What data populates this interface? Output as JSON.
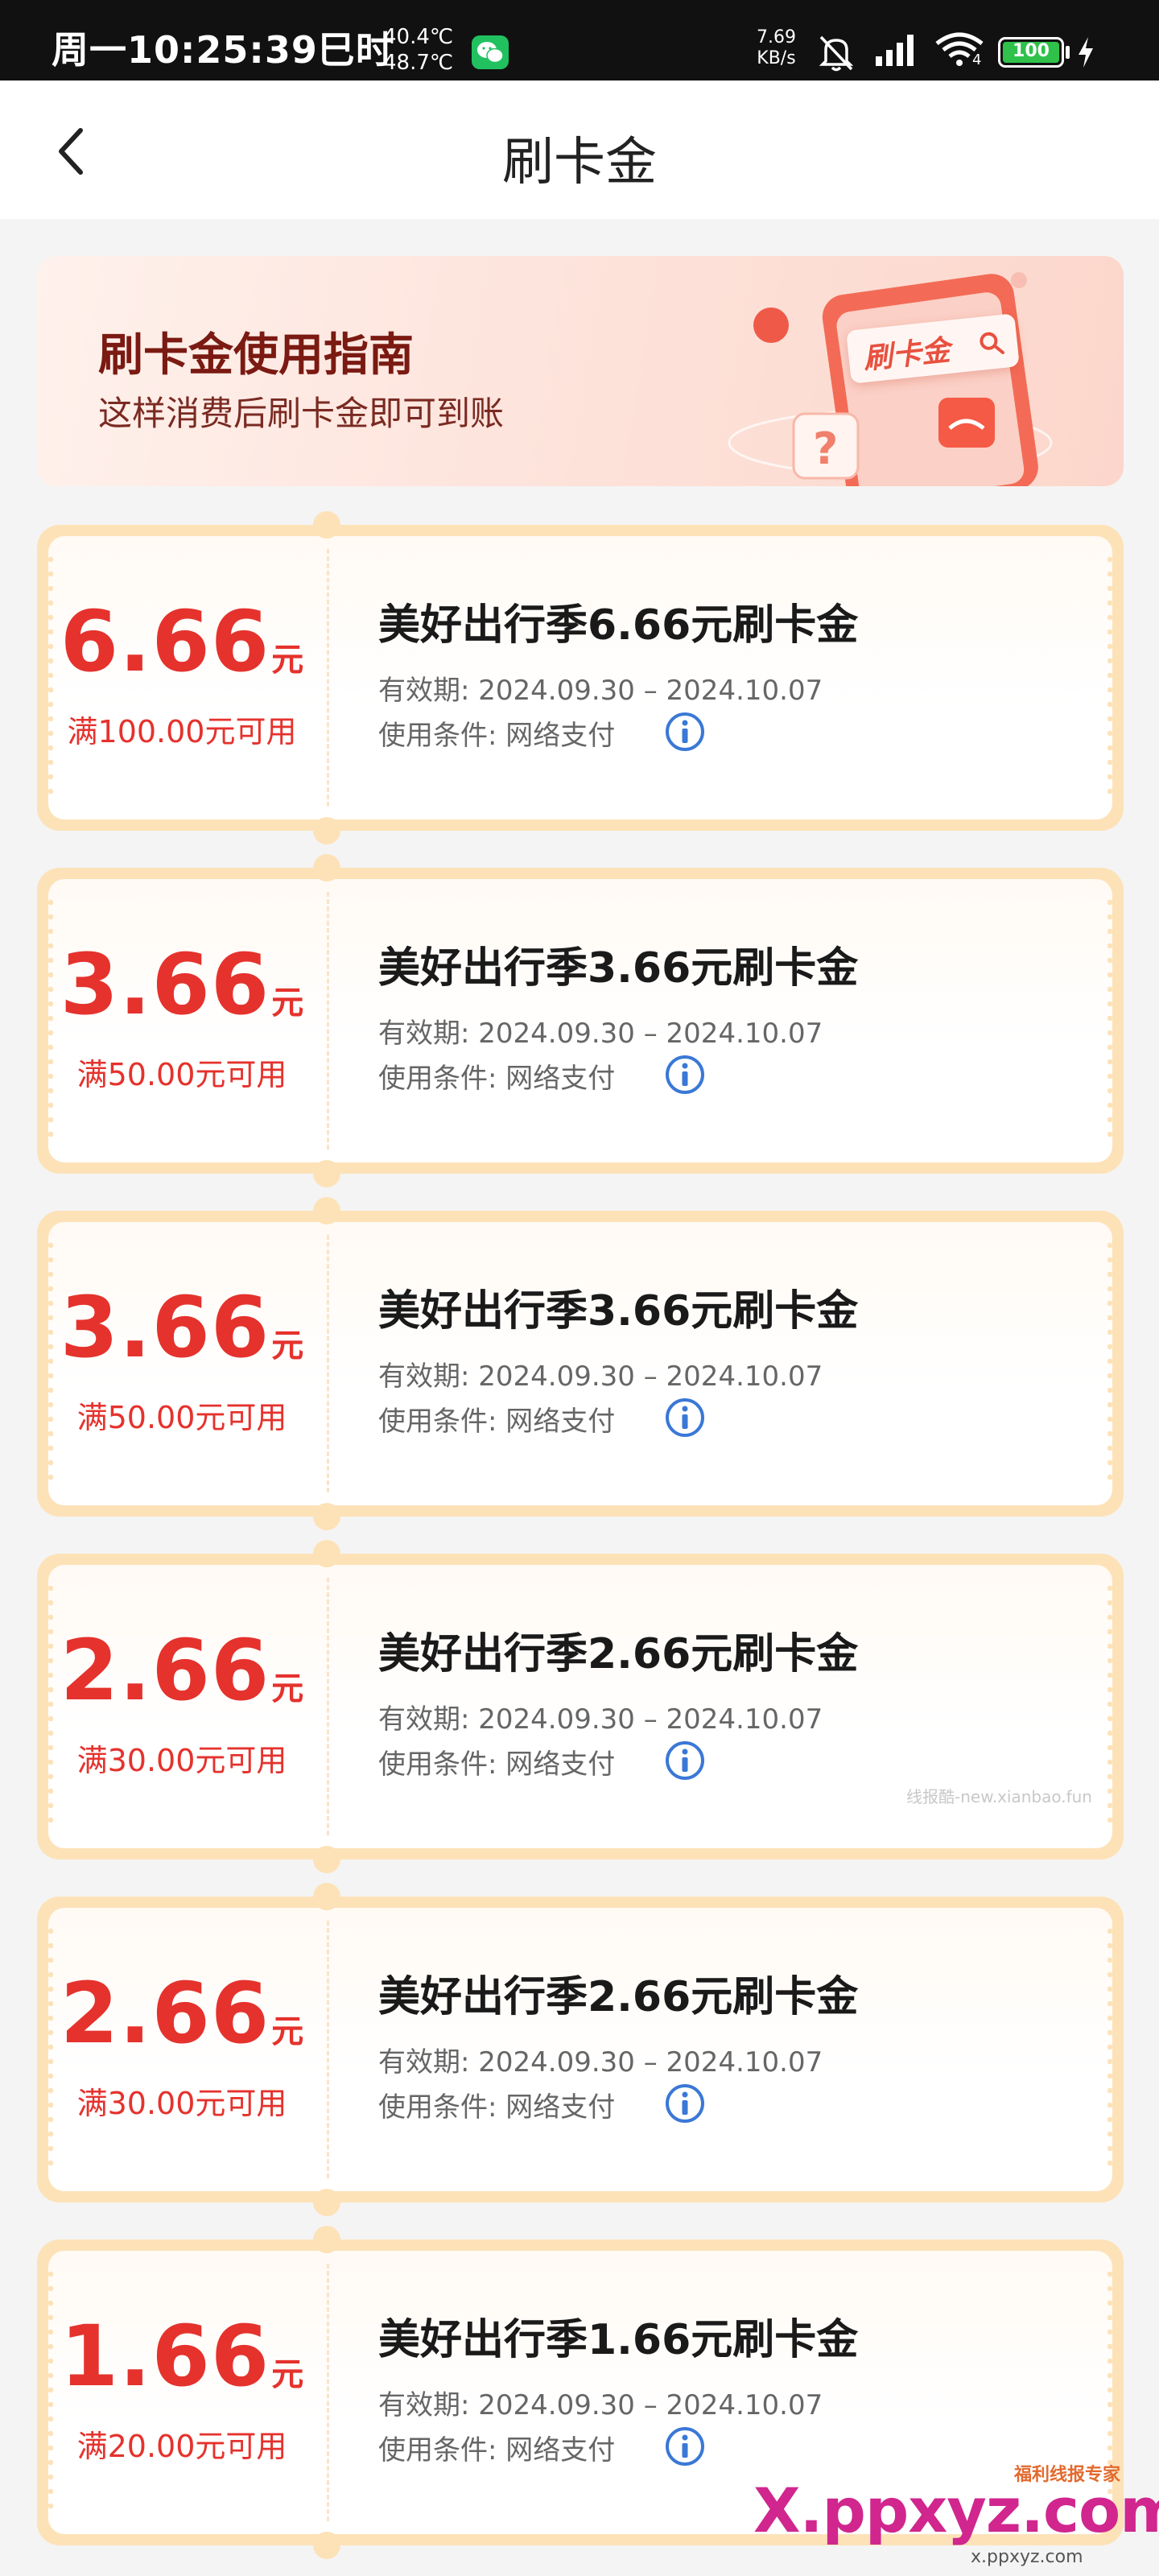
{
  "status_bar": {
    "time": "周一10:25:39巳时",
    "temp_1": "40.4℃",
    "temp_2": "48.7℃",
    "net_speed_value": "7.69",
    "net_speed_unit": "KB/s",
    "wifi_level": "4",
    "battery_level": "100"
  },
  "nav": {
    "title": "刷卡金"
  },
  "guide": {
    "title": "刷卡金使用指南",
    "subtitle": "这样消费后刷卡金即可到账",
    "chip_text": "刷卡金",
    "question_mark": "?"
  },
  "coupons": [
    {
      "amount": "6.66",
      "unit": "元",
      "condition": "满100.00元可用",
      "title": "美好出行季6.66元刷卡金",
      "validity": "有效期: 2024.09.30 – 2024.10.07",
      "usage": "使用条件: 网络支付"
    },
    {
      "amount": "3.66",
      "unit": "元",
      "condition": "满50.00元可用",
      "title": "美好出行季3.66元刷卡金",
      "validity": "有效期: 2024.09.30 – 2024.10.07",
      "usage": "使用条件: 网络支付"
    },
    {
      "amount": "3.66",
      "unit": "元",
      "condition": "满50.00元可用",
      "title": "美好出行季3.66元刷卡金",
      "validity": "有效期: 2024.09.30 – 2024.10.07",
      "usage": "使用条件: 网络支付"
    },
    {
      "amount": "2.66",
      "unit": "元",
      "condition": "满30.00元可用",
      "title": "美好出行季2.66元刷卡金",
      "validity": "有效期: 2024.09.30 – 2024.10.07",
      "usage": "使用条件: 网络支付"
    },
    {
      "amount": "2.66",
      "unit": "元",
      "condition": "满30.00元可用",
      "title": "美好出行季2.66元刷卡金",
      "validity": "有效期: 2024.09.30 – 2024.10.07",
      "usage": "使用条件: 网络支付"
    },
    {
      "amount": "1.66",
      "unit": "元",
      "condition": "满20.00元可用",
      "title": "美好出行季1.66元刷卡金",
      "validity": "有效期: 2024.09.30 – 2024.10.07",
      "usage": "使用条件: 网络支付"
    }
  ],
  "watermarks": {
    "small": "线报酷-new.xianbao.fun",
    "logo_badge": "福利线报专家",
    "logo_site": "X.ppxyz.com",
    "logo_site_small": "x.ppxyz.com"
  },
  "colors": {
    "accent_red": "#e5322d",
    "coupon_border": "#fde2b8",
    "info_blue": "#3a78d6"
  }
}
